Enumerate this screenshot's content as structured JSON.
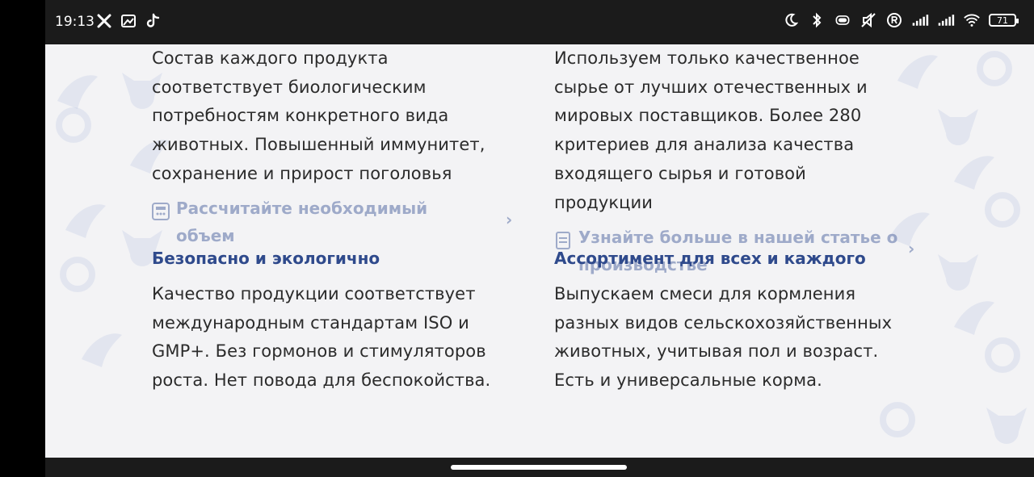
{
  "status_bar": {
    "time": "19:13",
    "left_icons": [
      "tools-icon",
      "gallery-icon",
      "tiktok-icon"
    ],
    "right_icons": [
      "moon-icon",
      "bluetooth-icon",
      "vibrate-icon",
      "mute-icon",
      "registered-icon",
      "signal-icon",
      "signal-icon",
      "wifi-icon"
    ],
    "battery": "71"
  },
  "columns": {
    "left": {
      "intro_lines": [
        "Состав каждого продукта",
        "соответствует биологическим",
        "потребностям конкретного вида",
        "животных. Повышенный иммунитет,",
        "сохранение и прирост поголовья"
      ],
      "link_label": "Рассчитайте необходимый объем",
      "heading": "Безопасно и экологично",
      "body_lines": [
        "Качество продукции соответствует",
        "международным стандартам ISO и",
        "GMP+. Без гормонов и стимуляторов",
        "роста. Нет повода для беспокойства."
      ]
    },
    "right": {
      "intro_lines": [
        "Используем только качественное",
        "сырье от лучших отечественных и",
        "мировых поставщиков. Более 280",
        "критериев для анализа качества",
        "входящего сырья и готовой",
        "продукции"
      ],
      "link_label": "Узнайте больше в нашей статье о производстве",
      "heading": "Ассортимент для всех и каждого",
      "body_lines": [
        "Выпускаем смеси для кормления",
        "разных видов сельскохозяйственных",
        "животных, учитывая пол и возраст.",
        "Есть и универсальные корма."
      ]
    }
  },
  "chevron": "›",
  "colors": {
    "accent": "#2f4a8c",
    "page_bg": "#f3f3f5",
    "text": "#2b2b2b"
  }
}
